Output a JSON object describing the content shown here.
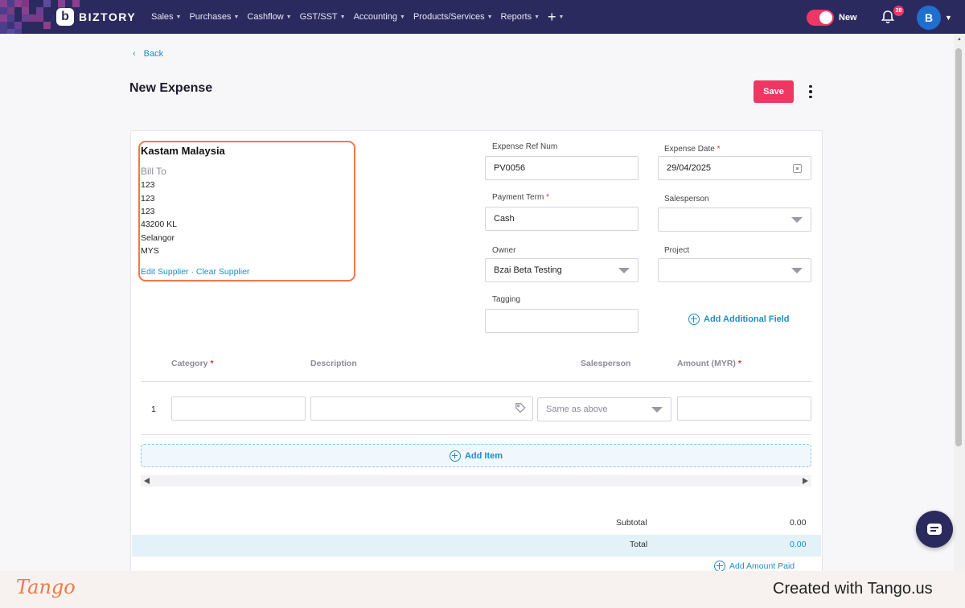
{
  "app": {
    "logo_text": "BIZTORY",
    "logo_mark": "b",
    "accent_color": "#ee3863",
    "nav_color": "#2b2a5f",
    "link_color": "#1d8ec6"
  },
  "nav": {
    "items": [
      {
        "label": "Sales"
      },
      {
        "label": "Purchases"
      },
      {
        "label": "Cashflow"
      },
      {
        "label": "GST/SST"
      },
      {
        "label": "Accounting"
      },
      {
        "label": "Products/Services"
      },
      {
        "label": "Reports"
      }
    ],
    "plus_label": "+",
    "toggle_label": "New",
    "notification_count": "28",
    "avatar_initial": "B"
  },
  "header": {
    "back_label": "Back",
    "title": "New Expense",
    "save_label": "Save"
  },
  "supplier": {
    "name": "Kastam Malaysia",
    "bill_to_label": "Bill To",
    "address_lines": [
      "123",
      "123",
      "123",
      "43200 KL",
      "Selangor",
      "MYS"
    ],
    "edit_label": "Edit Supplier",
    "separator": "·",
    "clear_label": "Clear Supplier"
  },
  "form": {
    "ref_num": {
      "label": "Expense Ref Num",
      "value": "PV0056"
    },
    "expense_date": {
      "label": "Expense Date",
      "value": "29/04/2025",
      "required": "*"
    },
    "payment_term": {
      "label": "Payment Term",
      "value": "Cash",
      "required": "*"
    },
    "salesperson": {
      "label": "Salesperson",
      "value": ""
    },
    "owner": {
      "label": "Owner",
      "value": "Bzai Beta Testing"
    },
    "project": {
      "label": "Project",
      "value": ""
    },
    "tagging": {
      "label": "Tagging",
      "value": ""
    },
    "add_field_label": "Add Additional Field"
  },
  "items_table": {
    "columns": [
      {
        "label": "Category",
        "required": "*"
      },
      {
        "label": "Description",
        "required": ""
      },
      {
        "label": "Salesperson",
        "required": ""
      },
      {
        "label": "Amount (MYR)",
        "required": "*"
      }
    ],
    "rows": [
      {
        "num": "1",
        "category": "",
        "description": "",
        "salesperson_placeholder": "Same as above",
        "amount": ""
      }
    ],
    "add_item_label": "Add Item"
  },
  "totals": {
    "subtotal_label": "Subtotal",
    "subtotal_value": "0.00",
    "total_label": "Total",
    "total_value": "0.00",
    "add_amount_paid_label": "Add Amount Paid"
  },
  "footer": {
    "tango_logo": "Tango",
    "credit": "Created with Tango.us"
  }
}
